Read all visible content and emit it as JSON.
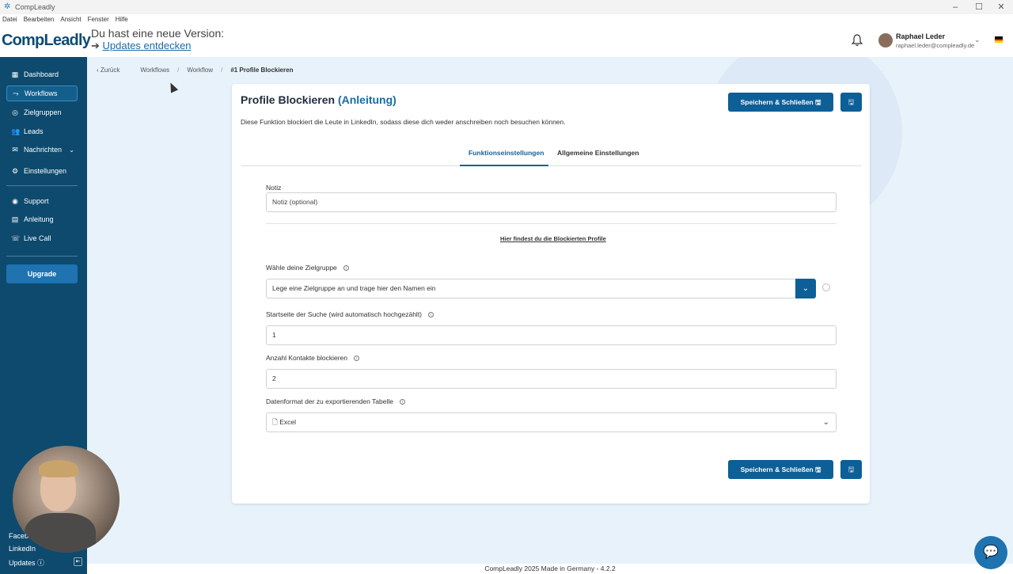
{
  "window": {
    "title": "CompLeadly"
  },
  "menu": [
    "Datei",
    "Bearbeiten",
    "Ansicht",
    "Fenster",
    "Hilfe"
  ],
  "header": {
    "logo": "CompLeadly",
    "update_text": "Du hast eine neue Version:",
    "update_link": "Updates entdecken",
    "user_name": "Raphael Leder",
    "user_email": "raphael.leder@compleadly.de"
  },
  "sidebar": {
    "items": [
      {
        "label": "Dashboard",
        "icon": "dashboard-icon"
      },
      {
        "label": "Workflows",
        "icon": "workflow-icon",
        "active": true
      },
      {
        "label": "Zielgruppen",
        "icon": "target-icon"
      },
      {
        "label": "Leads",
        "icon": "users-icon"
      },
      {
        "label": "Nachrichten",
        "icon": "messages-icon"
      },
      {
        "label": "Einstellungen",
        "icon": "gear-icon"
      },
      {
        "label": "Support",
        "icon": "support-icon"
      },
      {
        "label": "Anleitung",
        "icon": "book-icon"
      },
      {
        "label": "Live Call",
        "icon": "phone-icon"
      }
    ],
    "upgrade": "Upgrade",
    "bottom": [
      "Faceb",
      "LinkedIn",
      "Updates"
    ]
  },
  "breadcrumb": {
    "back": "Zurück",
    "items": [
      "Workflows",
      "Workflow",
      "#1 Profile Blockieren"
    ]
  },
  "card": {
    "title": "Profile Blockieren",
    "title_link": "(Anleitung)",
    "description": "Diese Funktion blockiert die Leute in LinkedIn, sodass diese dich weder anschreiben noch besuchen können.",
    "save_label": "Speichern & Schließen",
    "tabs": [
      "Funktionseinstellungen",
      "Allgemeine Einstellungen"
    ],
    "note_label": "Notiz",
    "note_placeholder": "Notiz (optional)",
    "blocked_link": "Hier findest du die Blockierten Profile",
    "audience_label": "Wähle deine Zielgruppe",
    "audience_placeholder": "Lege eine Zielgruppe an und trage hier den Namen ein",
    "start_label": "Startseite der Suche (wird automatisch hochgezählt)",
    "start_value": "1",
    "count_label": "Anzahl Kontakte blockieren",
    "count_value": "2",
    "format_label": "Datenformat der zu exportierenden Tabelle",
    "format_value": "Excel"
  },
  "footer": "CompLeadly  2025 Made in Germany - 4.2.2",
  "colors": {
    "sidebar": "#0d4a6e",
    "primary": "#0d5f98",
    "background": "#e8f2fb"
  }
}
